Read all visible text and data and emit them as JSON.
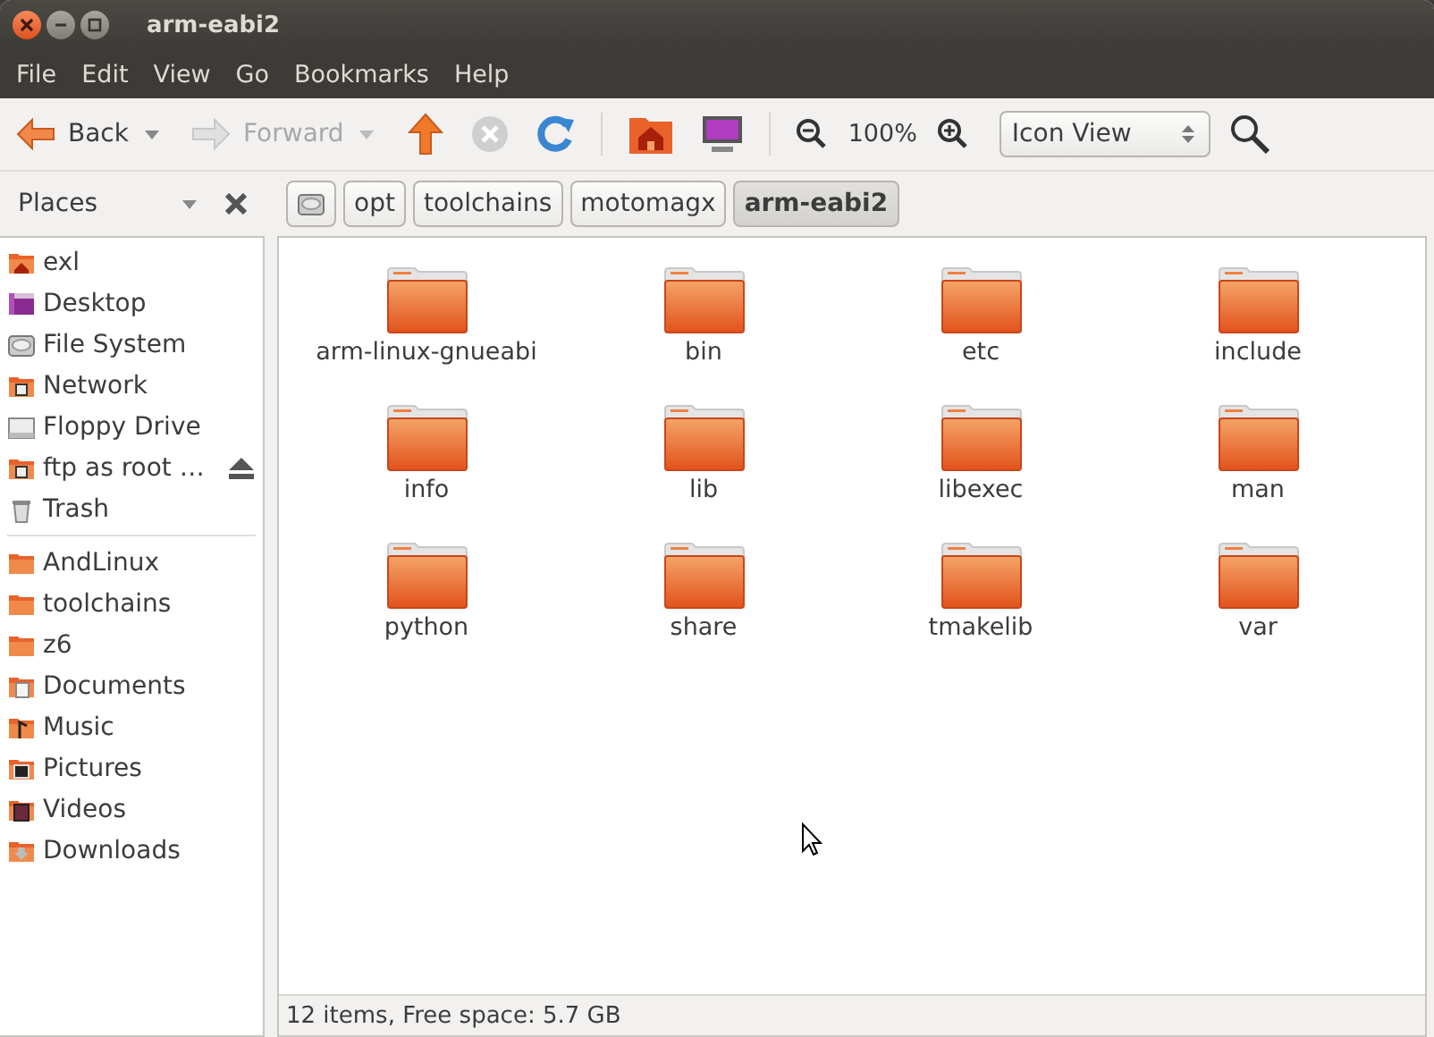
{
  "window": {
    "title": "arm-eabi2"
  },
  "menu": [
    "File",
    "Edit",
    "View",
    "Go",
    "Bookmarks",
    "Help"
  ],
  "toolbar": {
    "back": {
      "label": "Back",
      "disabled": false
    },
    "forward": {
      "label": "Forward",
      "disabled": true
    },
    "stop": {
      "disabled": true
    },
    "zoom": "100%",
    "view": "Icon View"
  },
  "sidebar": {
    "title": "Places",
    "sections": [
      [
        {
          "label": "exl",
          "kind": "home"
        },
        {
          "label": "Desktop",
          "kind": "desktop"
        },
        {
          "label": "File System",
          "kind": "drive"
        },
        {
          "label": "Network",
          "kind": "network"
        },
        {
          "label": "Floppy Drive",
          "kind": "floppy"
        },
        {
          "label": "ftp as root …",
          "kind": "network",
          "eject": true
        },
        {
          "label": "Trash",
          "kind": "trash"
        }
      ],
      [
        {
          "label": "AndLinux",
          "kind": "folder"
        },
        {
          "label": "toolchains",
          "kind": "folder"
        },
        {
          "label": "z6",
          "kind": "folder"
        },
        {
          "label": "Documents",
          "kind": "documents"
        },
        {
          "label": "Music",
          "kind": "music"
        },
        {
          "label": "Pictures",
          "kind": "pictures"
        },
        {
          "label": "Videos",
          "kind": "videos"
        },
        {
          "label": "Downloads",
          "kind": "downloads"
        }
      ]
    ]
  },
  "pathbar": [
    {
      "label": "opt",
      "selected": false
    },
    {
      "label": "toolchains",
      "selected": false
    },
    {
      "label": "motomagx",
      "selected": false
    },
    {
      "label": "arm-eabi2",
      "selected": true
    }
  ],
  "files": [
    "arm-linux-gnueabi",
    "bin",
    "etc",
    "include",
    "info",
    "lib",
    "libexec",
    "man",
    "python",
    "share",
    "tmakelib",
    "var"
  ],
  "status_bar": "12 items, Free space: 5.7 GB"
}
